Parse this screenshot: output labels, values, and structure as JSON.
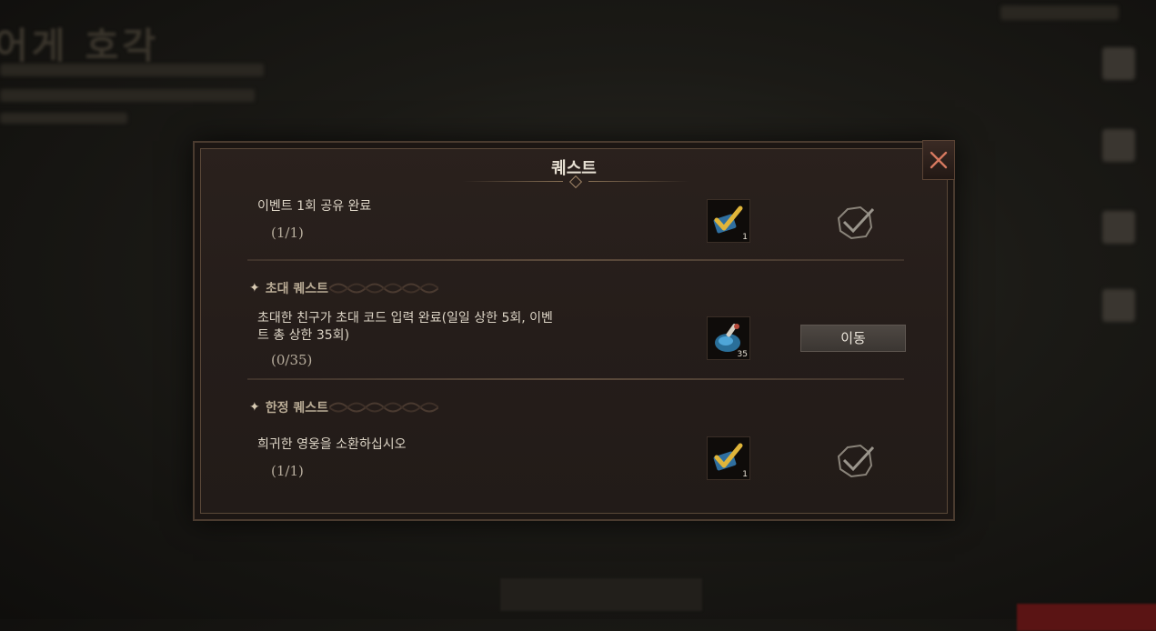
{
  "modal": {
    "title": "퀘스트"
  },
  "quests": [
    {
      "title": "이벤트 1회 공유 완료",
      "progress": "(1/1)",
      "reward_qty": "1",
      "status": "complete"
    },
    {
      "section": "초대 퀘스트",
      "title_line1": "초대한 친구가 초대 코드 입력 완료(일일 상한 5회, 이벤",
      "title_line2": "트 총 상한 35회)",
      "progress": "(0/35)",
      "reward_qty": "35",
      "action_label": "이동",
      "status": "in_progress"
    },
    {
      "section": "한정 퀘스트",
      "title": "희귀한 영웅을 소환하십시오",
      "progress": "(1/1)",
      "reward_qty": "1",
      "status": "complete"
    }
  ],
  "icons": {
    "close": "close-x-icon",
    "reward_check": "gold-check-ticket-icon",
    "reward_potion": "blue-potion-icon",
    "completed": "completed-check-icon",
    "section_marker": "four-point-star-icon"
  },
  "colors": {
    "close_x": "#d5785f",
    "gold_check": "#e0b53a",
    "potion_blue": "#4fa6d8"
  }
}
